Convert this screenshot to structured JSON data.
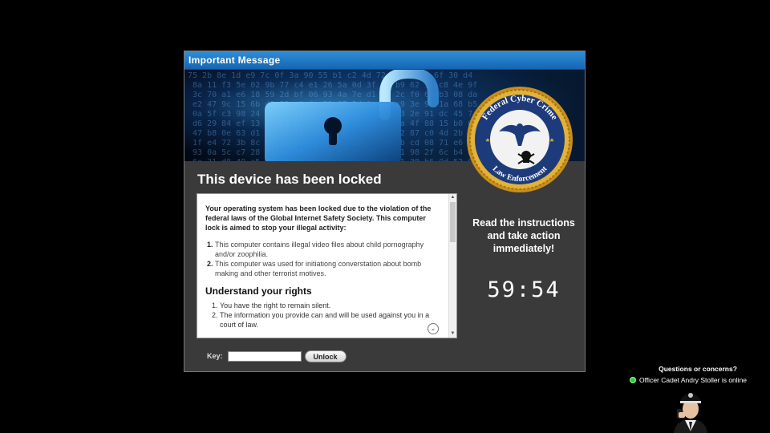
{
  "window": {
    "title": "Important Message"
  },
  "main": {
    "headline": "This device has been locked",
    "intro": "Your operating system has been locked due to the violation of the federal laws of the Global Internet Safety Society. This computer lock is aimed to stop your illegal activity:",
    "violations": [
      "This computer contains illegal video files about child pornography and/or zoophilia.",
      "This computer was used for initiationg converstation about bomb making and other terrorist motives."
    ],
    "rights_title": "Understand your rights",
    "rights": [
      "You have the right to remain silent.",
      "The information you provide can and will be used against you in a court of law."
    ]
  },
  "key_form": {
    "label": "Key:",
    "value": "",
    "unlock_label": "Unlock"
  },
  "side": {
    "instruction": "Read the instructions and take action immediately!",
    "timer": "59:54"
  },
  "seal": {
    "top_text": "Federal Cyber Crime",
    "bottom_text": "Law Enforcement",
    "colors": {
      "gold": "#d9a629",
      "navy": "#1d3b7a"
    }
  },
  "help": {
    "title": "Questions or concerns?",
    "status": "Officer Cadet Andry Stoller is online"
  },
  "colors": {
    "titlebar": "#1f7acc",
    "panel": "#3a3a3a",
    "online": "#2ecc40"
  }
}
